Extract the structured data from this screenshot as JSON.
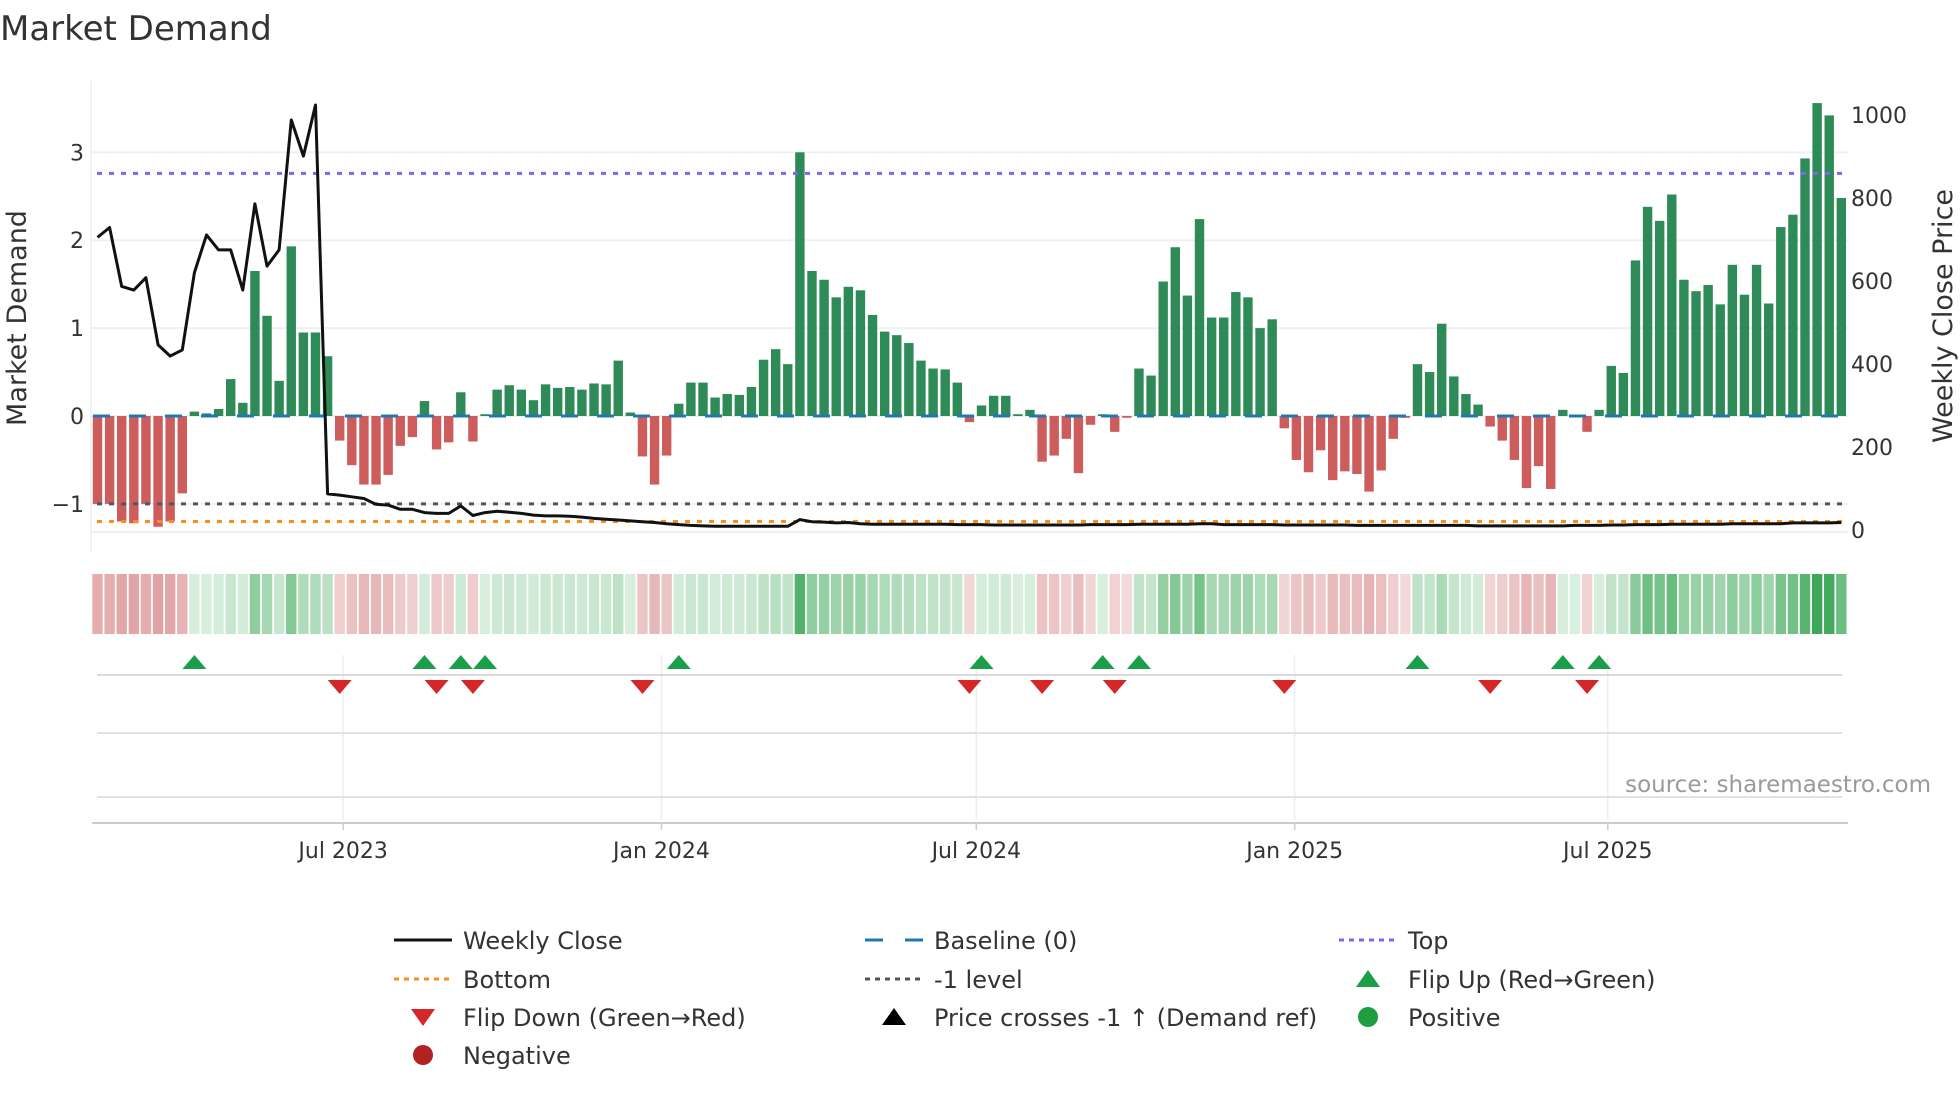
{
  "title": "Market Demand",
  "source": "source: sharemaestro.com",
  "colors": {
    "positive_bar": "#2e8b57",
    "negative_bar": "#cd5c5c",
    "price_line": "#111111",
    "baseline": "#1f77b4",
    "top": "#7b68ee",
    "bottom": "#ff8c1a",
    "minus_one": "#555555",
    "flip_up": "#1a9e4a",
    "flip_down": "#d62728",
    "positive_marker": "#1f9e3f",
    "negative_marker": "#b22222"
  },
  "legend": [
    {
      "label": "Weekly Close",
      "symbol": "solid-line"
    },
    {
      "label": "Baseline (0)",
      "symbol": "dashed-line"
    },
    {
      "label": "Top",
      "symbol": "dotted-line"
    },
    {
      "label": "Bottom",
      "symbol": "dotted-line"
    },
    {
      "label": "-1 level",
      "symbol": "dotted-line"
    },
    {
      "label": "Flip Up (Red→Green)",
      "symbol": "triangle-up"
    },
    {
      "label": "Flip Down (Green→Red)",
      "symbol": "triangle-down"
    },
    {
      "label": "Price crosses -1 ↑ (Demand ref)",
      "symbol": "triangle-up"
    },
    {
      "label": "Positive",
      "symbol": "circle"
    },
    {
      "label": "Negative",
      "symbol": "circle"
    }
  ],
  "chart_data": {
    "type": "bar",
    "title": "Market Demand",
    "ylabel": "Market Demand",
    "y2label": "Weekly Close Price",
    "ylim": [
      -1.35,
      3.9
    ],
    "y2lim": [
      0,
      1050
    ],
    "x_start": "2023-02-09",
    "x_freq": "weekly",
    "yticks": [
      {
        "v": 3,
        "label": "3"
      },
      {
        "v": 2,
        "label": "2"
      },
      {
        "v": 1,
        "label": "1"
      },
      {
        "v": 0,
        "label": "0"
      },
      {
        "v": -1,
        "label": "−1"
      }
    ],
    "y2ticks": [
      {
        "v": 0,
        "label": "0"
      },
      {
        "v": 200,
        "label": "200"
      },
      {
        "v": 400,
        "label": "400"
      },
      {
        "v": 600,
        "label": "600"
      },
      {
        "v": 800,
        "label": "800"
      },
      {
        "v": 1000,
        "label": "1000"
      }
    ],
    "xticks": [
      {
        "date": "2023-07-01",
        "label": "Jul 2023"
      },
      {
        "date": "2024-01-01",
        "label": "Jan 2024"
      },
      {
        "date": "2024-07-01",
        "label": "Jul 2024"
      },
      {
        "date": "2025-01-01",
        "label": "Jan 2025"
      },
      {
        "date": "2025-07-01",
        "label": "Jul 2025"
      }
    ],
    "reference_lines": {
      "top": 2.76,
      "baseline": 0,
      "minus_one": -1,
      "bottom": -1.2
    },
    "demand": [
      -1.0,
      -1.0,
      -1.2,
      -1.22,
      -1.0,
      -1.26,
      -1.2,
      -0.88,
      0.05,
      0.03,
      0.08,
      0.42,
      0.15,
      1.65,
      1.14,
      0.4,
      1.93,
      0.95,
      0.95,
      0.68,
      -0.28,
      -0.56,
      -0.78,
      -0.78,
      -0.67,
      -0.34,
      -0.24,
      0.17,
      -0.38,
      -0.3,
      0.27,
      -0.29,
      0.02,
      0.3,
      0.35,
      0.3,
      0.18,
      0.36,
      0.32,
      0.33,
      0.3,
      0.37,
      0.36,
      0.63,
      0.04,
      -0.46,
      -0.78,
      -0.45,
      0.14,
      0.38,
      0.38,
      0.21,
      0.25,
      0.24,
      0.33,
      0.64,
      0.76,
      0.59,
      3.0,
      1.65,
      1.55,
      1.35,
      1.47,
      1.43,
      1.15,
      0.96,
      0.92,
      0.83,
      0.63,
      0.54,
      0.53,
      0.38,
      -0.07,
      0.12,
      0.23,
      0.23,
      0.02,
      0.07,
      -0.52,
      -0.45,
      -0.26,
      -0.65,
      -0.1,
      0.02,
      -0.18,
      -0.02,
      0.54,
      0.46,
      1.53,
      1.92,
      1.37,
      2.24,
      1.12,
      1.12,
      1.41,
      1.35,
      1.0,
      1.1,
      -0.14,
      -0.5,
      -0.64,
      -0.39,
      -0.73,
      -0.63,
      -0.66,
      -0.86,
      -0.62,
      -0.26,
      -0.02,
      0.59,
      0.5,
      1.05,
      0.45,
      0.25,
      0.13,
      -0.12,
      -0.28,
      -0.5,
      -0.82,
      -0.57,
      -0.83,
      0.07,
      0.01,
      -0.18,
      0.07,
      0.57,
      0.49,
      1.77,
      2.38,
      2.22,
      2.52,
      1.55,
      1.42,
      1.49,
      1.27,
      1.72,
      1.38,
      1.72,
      1.28,
      2.15,
      2.29,
      2.93,
      3.56,
      3.42,
      2.48
    ],
    "price": [
      705,
      729,
      587,
      578,
      608,
      446,
      419,
      434,
      620,
      711,
      675,
      675,
      578,
      786,
      636,
      675,
      988,
      901,
      1024,
      87,
      84,
      80,
      76,
      62,
      60,
      50,
      50,
      42,
      40,
      40,
      58,
      35,
      42,
      45,
      43,
      40,
      36,
      34,
      34,
      33,
      31,
      28,
      26,
      24,
      22,
      20,
      18,
      15,
      13,
      11,
      10,
      9,
      9,
      9,
      9,
      9,
      9,
      9,
      25,
      20,
      19,
      17,
      18,
      15,
      14,
      14,
      14,
      14,
      14,
      14,
      14,
      13,
      13,
      13,
      12,
      12,
      12,
      12,
      12,
      12,
      12,
      12,
      13,
      13,
      13,
      13,
      14,
      14,
      14,
      14,
      14,
      15,
      15,
      13,
      13,
      13,
      13,
      13,
      12,
      12,
      12,
      12,
      12,
      12,
      11,
      11,
      11,
      11,
      11,
      11,
      11,
      11,
      11,
      11,
      10,
      10,
      10,
      10,
      10,
      10,
      10,
      10,
      11,
      11,
      11,
      12,
      12,
      13,
      13,
      13,
      14,
      14,
      14,
      14,
      14,
      15,
      15,
      15,
      15,
      15,
      17,
      17,
      17,
      17,
      18
    ],
    "flip_up_weeks": [
      8,
      27,
      30,
      32,
      48,
      73,
      83,
      86,
      109,
      121,
      124
    ],
    "flip_down_weeks": [
      20,
      28,
      31,
      45,
      72,
      78,
      84,
      98,
      115,
      123
    ],
    "legend_position": "bottom"
  }
}
